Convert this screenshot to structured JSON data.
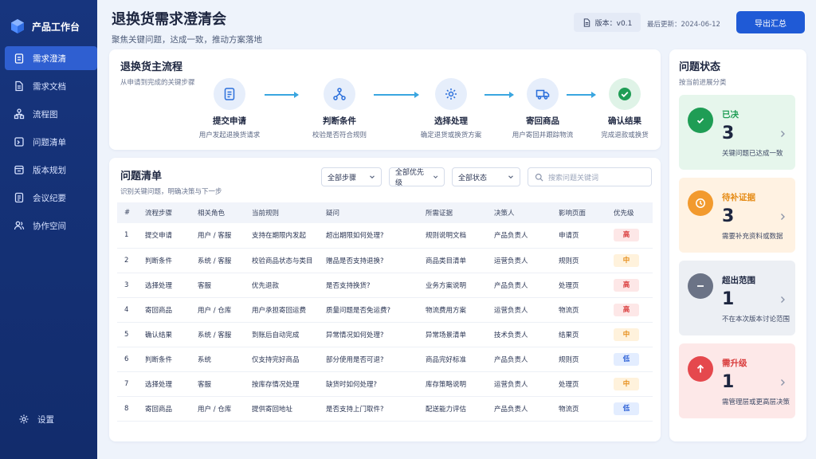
{
  "app": {
    "name": "产品工作台"
  },
  "nav": {
    "items": [
      {
        "label": "需求澄清",
        "icon": "clipboard-icon",
        "active": true
      },
      {
        "label": "需求文档",
        "icon": "document-icon"
      },
      {
        "label": "流程图",
        "icon": "flowchart-icon"
      },
      {
        "label": "问题清单",
        "icon": "issue-list-icon"
      },
      {
        "label": "版本规划",
        "icon": "calendar-icon"
      },
      {
        "label": "会议纪要",
        "icon": "notes-icon"
      },
      {
        "label": "协作空间",
        "icon": "team-icon"
      }
    ],
    "settings": "设置"
  },
  "header": {
    "title": "退换货需求澄清会",
    "subtitle": "聚焦关键问题，达成一致，推动方案落地",
    "version": "版本：v0.1",
    "updated": "最后更新：2024-06-12",
    "export": "导出汇总"
  },
  "flow": {
    "title": "退换货主流程",
    "subtitle": "从申请到完成的关键步骤",
    "steps": [
      {
        "name": "提交申请",
        "desc": "用户发起退换货请求",
        "icon": "form-icon"
      },
      {
        "name": "判断条件",
        "desc": "校验是否符合规则",
        "icon": "branch-icon"
      },
      {
        "name": "选择处理",
        "desc": "确定退货或换货方案",
        "icon": "gear-icon"
      },
      {
        "name": "寄回商品",
        "desc": "用户寄回并跟踪物流",
        "icon": "truck-icon"
      },
      {
        "name": "确认结果",
        "desc": "完成退款或换货",
        "icon": "check-icon"
      }
    ]
  },
  "issues": {
    "title": "问题清单",
    "subtitle": "识别关键问题，明确决策与下一步",
    "filters": [
      "全部步骤",
      "全部优先级",
      "全部状态"
    ],
    "search_placeholder": "搜索问题关键词",
    "columns": [
      "#",
      "流程步骤",
      "相关角色",
      "当前规则",
      "疑问",
      "所需证据",
      "决策人",
      "影响页面",
      "优先级"
    ],
    "rows": [
      [
        "1",
        "提交申请",
        "用户 / 客服",
        "支持在期限内发起",
        "超出期限如何处理?",
        "规则说明文档",
        "产品负责人",
        "申请页",
        "高"
      ],
      [
        "2",
        "判断条件",
        "系统 / 客服",
        "校验商品状态与类目",
        "赠品是否支持退换?",
        "商品类目清单",
        "运营负责人",
        "规则页",
        "中"
      ],
      [
        "3",
        "选择处理",
        "客服",
        "优先退款",
        "是否支持换货?",
        "业务方案说明",
        "产品负责人",
        "处理页",
        "高"
      ],
      [
        "4",
        "寄回商品",
        "用户 / 仓库",
        "用户承担寄回运费",
        "质量问题是否免运费?",
        "物流费用方案",
        "运营负责人",
        "物流页",
        "高"
      ],
      [
        "5",
        "确认结果",
        "系统 / 客服",
        "到账后自动完成",
        "异常情况如何处理?",
        "异常场景清单",
        "技术负责人",
        "结果页",
        "中"
      ],
      [
        "6",
        "判断条件",
        "系统",
        "仅支持完好商品",
        "部分使用是否可退?",
        "商品完好标准",
        "产品负责人",
        "规则页",
        "低"
      ],
      [
        "7",
        "选择处理",
        "客服",
        "按库存情况处理",
        "缺货时如何处理?",
        "库存策略说明",
        "运营负责人",
        "处理页",
        "中"
      ],
      [
        "8",
        "寄回商品",
        "用户 / 仓库",
        "提供寄回地址",
        "是否支持上门取件?",
        "配送能力评估",
        "产品负责人",
        "物流页",
        "低"
      ]
    ]
  },
  "status": {
    "title": "问题状态",
    "subtitle": "按当前进展分类",
    "cards": [
      {
        "label": "已决",
        "count": "3",
        "desc": "关键问题已达成一致",
        "icon": "check-circle-icon",
        "bg": "#e6f6ec",
        "color": "#1f9d55",
        "label_color": "#1f9d55"
      },
      {
        "label": "待补证据",
        "count": "3",
        "desc": "需要补充资料或数据",
        "icon": "clock-icon",
        "bg": "#fff2e2",
        "color": "#f29a2e",
        "label_color": "#e58a13"
      },
      {
        "label": "超出范围",
        "count": "1",
        "desc": "不在本次版本讨论范围",
        "icon": "minus-circle-icon",
        "bg": "#eceff4",
        "color": "#6b7386",
        "label_color": "#1d2640"
      },
      {
        "label": "需升级",
        "count": "1",
        "desc": "需管理层或更高层决策",
        "icon": "arrow-up-circle-icon",
        "bg": "#fde8e8",
        "color": "#e5484d",
        "label_color": "#d93b3b"
      }
    ]
  },
  "colors": {
    "sidebar": "#17357e",
    "accent": "#1f5ad6",
    "high": "#d93b3b",
    "mid": "#e58a13",
    "low": "#2f62d6"
  }
}
